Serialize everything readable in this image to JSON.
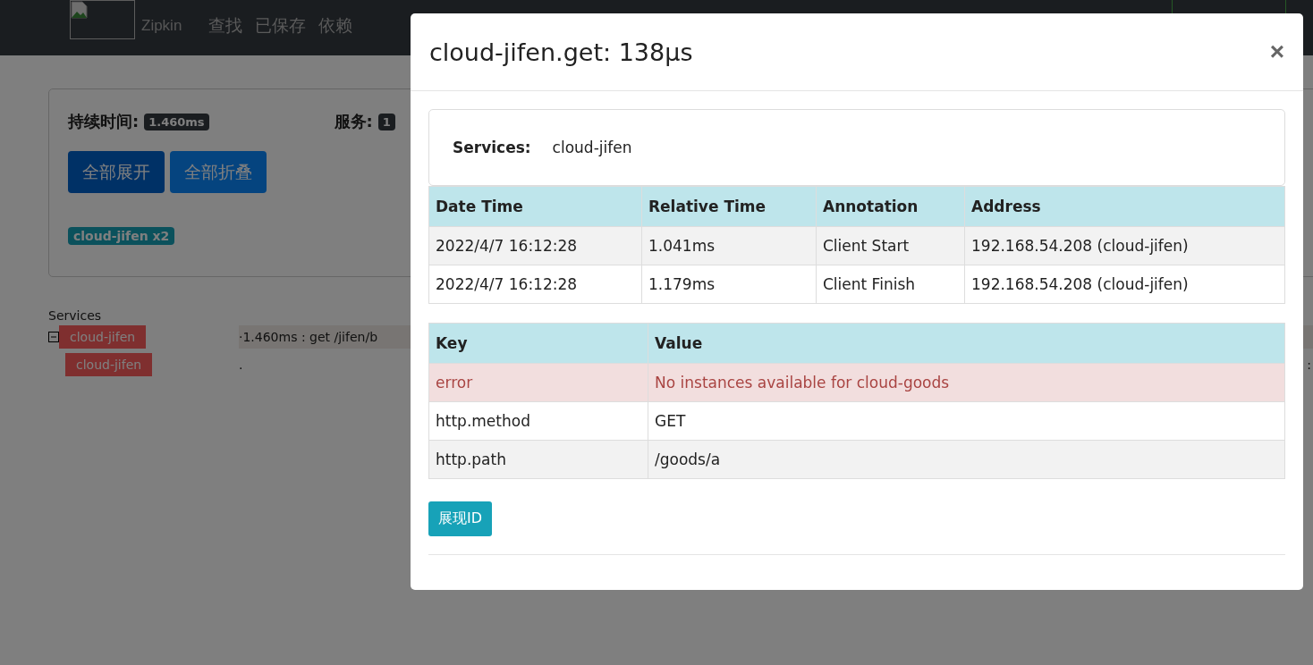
{
  "navbar": {
    "brand": "Zipkin",
    "links": [
      "查找",
      "已保存",
      "依赖"
    ]
  },
  "summary": {
    "duration_label": "持续时间:",
    "duration": "1.460ms",
    "services_label": "服务:",
    "services_count": "1",
    "buttons": [
      "全部展开",
      "全部折叠"
    ],
    "service_badges": [
      "cloud-jifen x2"
    ]
  },
  "trace": {
    "heading": "Services",
    "spans": [
      {
        "service": "cloud-jifen",
        "bar_text": "·1.460ms : get /jifen/b",
        "expanded": true,
        "children": [
          {
            "service": "cloud-jifen",
            "bar_text": ".",
            "edge_text": ":"
          }
        ]
      }
    ]
  },
  "modal": {
    "title": "cloud-jifen.get: 138µs",
    "close": "×",
    "services_label": "Services:",
    "services_value": "cloud-jifen",
    "annotations": {
      "columns": [
        "Date Time",
        "Relative Time",
        "Annotation",
        "Address"
      ],
      "rows": [
        [
          "2022/4/7 16:12:28",
          "1.041ms",
          "Client Start",
          "192.168.54.208 (cloud-jifen)"
        ],
        [
          "2022/4/7 16:12:28",
          "1.179ms",
          "Client Finish",
          "192.168.54.208 (cloud-jifen)"
        ]
      ]
    },
    "tags": {
      "columns": [
        "Key",
        "Value"
      ],
      "rows": [
        {
          "kind": "error",
          "key": "error",
          "value": "No instances available for cloud-goods"
        },
        {
          "kind": "normal",
          "key": "http.method",
          "value": "GET"
        },
        {
          "kind": "normal",
          "key": "http.path",
          "value": "/goods/a"
        }
      ]
    },
    "button": "展现ID"
  }
}
